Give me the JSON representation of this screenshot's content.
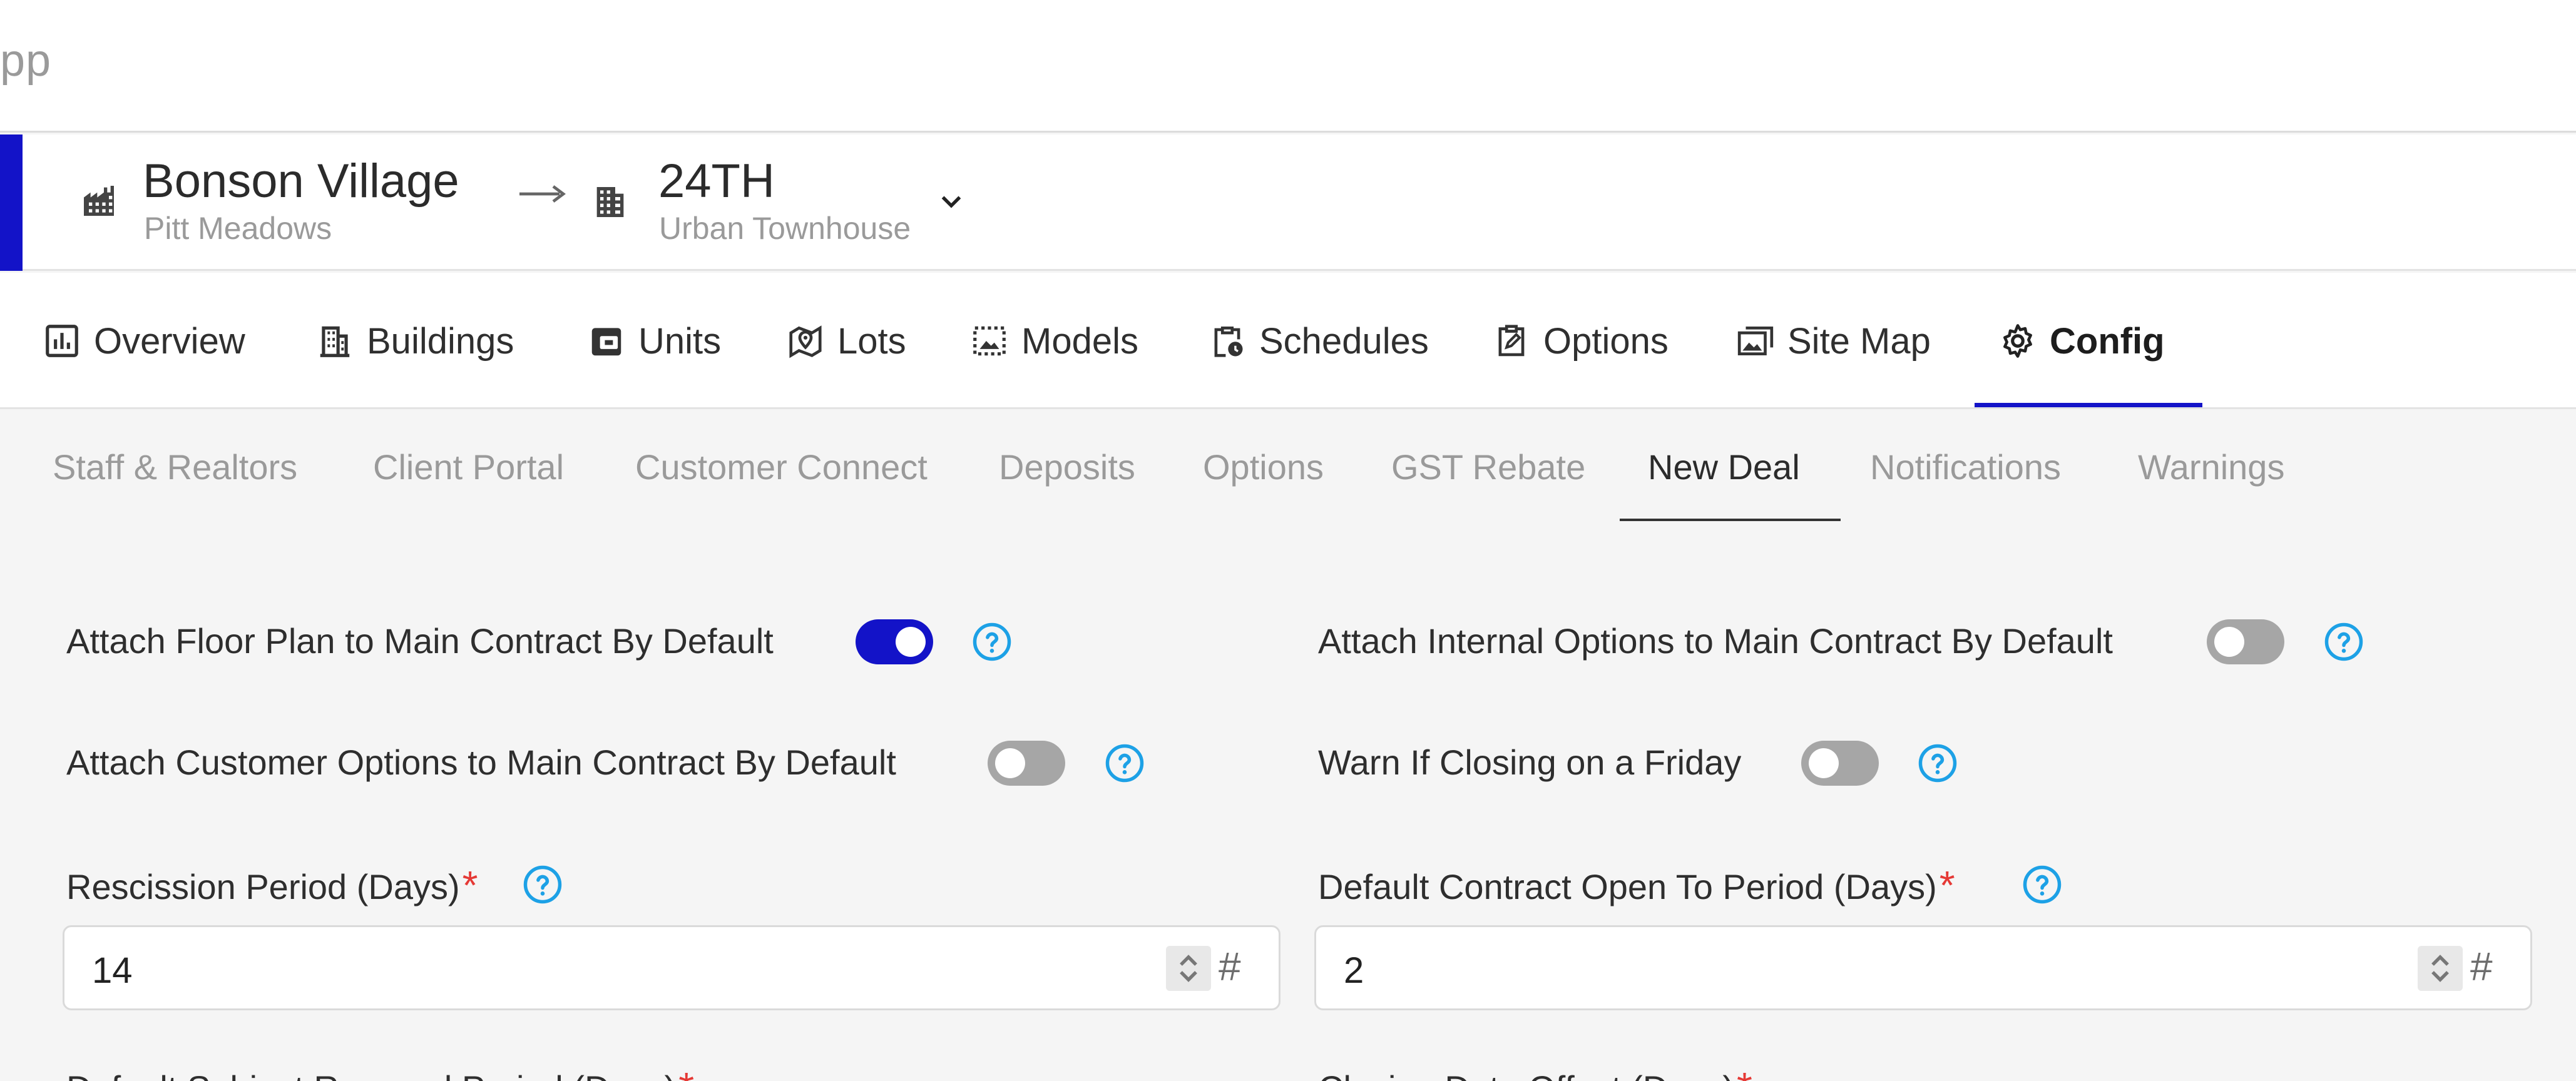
{
  "app": {
    "title_fragment": "pp"
  },
  "project": {
    "community_name": "Bonson Village",
    "community_location": "Pitt Meadows",
    "phase_name": "24TH",
    "phase_type": "Urban Townhouse",
    "accent_color": "#1313c8"
  },
  "main_tabs": [
    {
      "label": "Overview",
      "icon": "chart-icon"
    },
    {
      "label": "Buildings",
      "icon": "building-icon"
    },
    {
      "label": "Units",
      "icon": "unit-icon"
    },
    {
      "label": "Lots",
      "icon": "map-pin-icon"
    },
    {
      "label": "Models",
      "icon": "image-frame-icon"
    },
    {
      "label": "Schedules",
      "icon": "clipboard-clock-icon"
    },
    {
      "label": "Options",
      "icon": "clipboard-edit-icon"
    },
    {
      "label": "Site Map",
      "icon": "images-icon"
    },
    {
      "label": "Config",
      "icon": "gear-icon",
      "active": true
    }
  ],
  "sub_tabs": [
    {
      "label": "Staff & Realtors"
    },
    {
      "label": "Client Portal"
    },
    {
      "label": "Customer Connect"
    },
    {
      "label": "Deposits"
    },
    {
      "label": "Options"
    },
    {
      "label": "GST Rebate"
    },
    {
      "label": "New Deal",
      "active": true
    },
    {
      "label": "Notifications"
    },
    {
      "label": "Warnings"
    }
  ],
  "settings": {
    "attach_floor_plan": {
      "label": "Attach Floor Plan to Main Contract By Default",
      "enabled": true
    },
    "attach_internal_options": {
      "label": "Attach Internal Options to Main Contract By Default",
      "enabled": false
    },
    "attach_customer_options": {
      "label": "Attach Customer Options to Main Contract By Default",
      "enabled": false
    },
    "warn_closing_friday": {
      "label": "Warn If Closing on a Friday",
      "enabled": false
    },
    "rescission_period": {
      "label": "Rescission Period (Days)",
      "required": "*",
      "value": "14",
      "suffix": "#"
    },
    "contract_open_period": {
      "label": "Default Contract Open To Period (Days)",
      "required": "*",
      "value": "2",
      "suffix": "#"
    },
    "subject_removal_period": {
      "label": "Default Subject Removal Period (Days)",
      "required": "*"
    },
    "closing_date_offset": {
      "label": "Closing Date Offset (Days)",
      "required": "*"
    }
  },
  "colors": {
    "help_icon": "#1da1e6",
    "toggle_on": "#1313c8",
    "toggle_off": "#a6a6a6",
    "required": "#e53935"
  }
}
